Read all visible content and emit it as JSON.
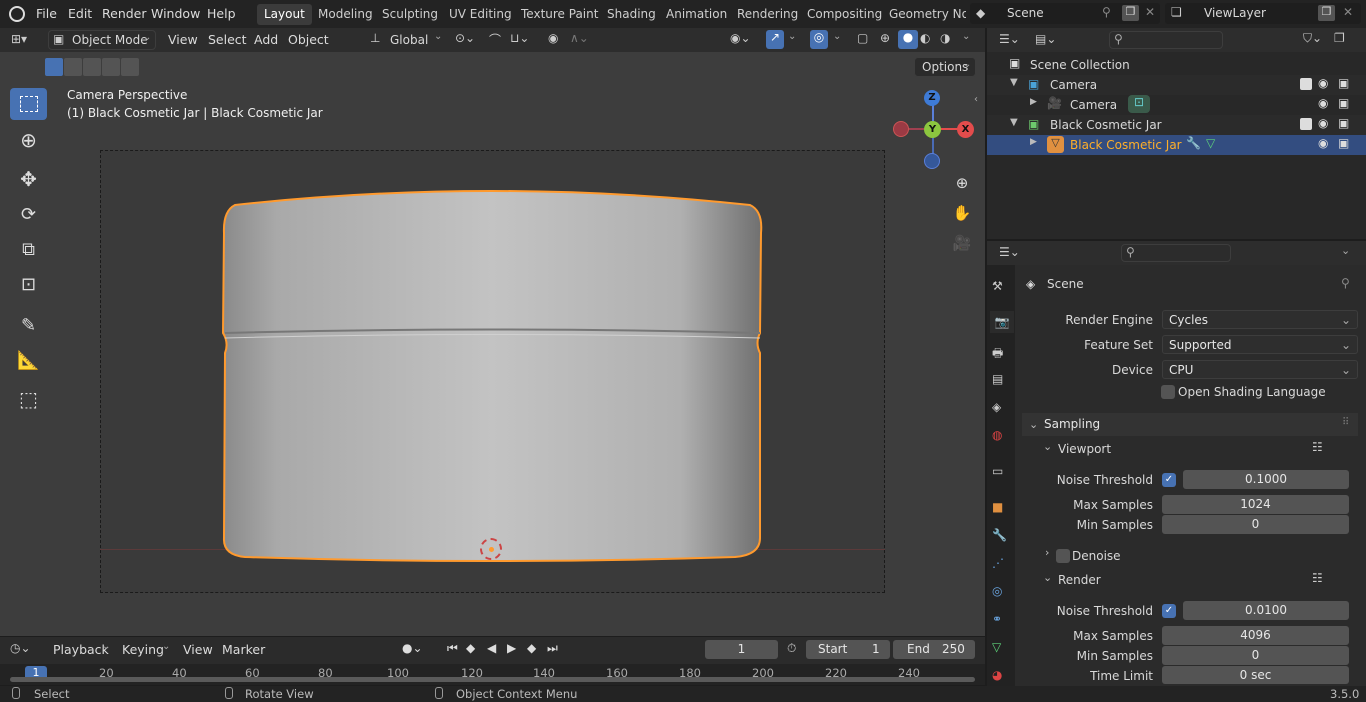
{
  "topbar": {
    "menus": [
      "File",
      "Edit",
      "Render",
      "Window",
      "Help"
    ],
    "workspaces": [
      "Layout",
      "Modeling",
      "Sculpting",
      "UV Editing",
      "Texture Paint",
      "Shading",
      "Animation",
      "Rendering",
      "Compositing",
      "Geometry Noc"
    ],
    "scene": "Scene",
    "view_layer": "ViewLayer"
  },
  "viewport": {
    "mode": "Object Mode",
    "menus": [
      "View",
      "Select",
      "Add",
      "Object"
    ],
    "orientation": "Global",
    "options": "Options",
    "overlay_title": "Camera Perspective",
    "overlay_subtitle": "(1) Black Cosmetic Jar | Black Cosmetic Jar",
    "gizmo": {
      "z": "Z",
      "y": "Y",
      "x": "X"
    },
    "accent": "#ff9a2e"
  },
  "outliner": {
    "rows": [
      {
        "label": "Scene Collection"
      },
      {
        "label": "Camera"
      },
      {
        "label": "Camera"
      },
      {
        "label": "Black Cosmetic Jar"
      },
      {
        "label": "Black Cosmetic Jar"
      }
    ]
  },
  "properties": {
    "title": "Scene",
    "render_engine_label": "Render Engine",
    "render_engine": "Cycles",
    "feature_set_label": "Feature Set",
    "feature_set": "Supported",
    "device_label": "Device",
    "device": "CPU",
    "osl_label": "Open Shading Language",
    "sampling": "Sampling",
    "viewport": "Viewport",
    "vp_noise_label": "Noise Threshold",
    "vp_noise": "0.1000",
    "vp_max_label": "Max Samples",
    "vp_max": "1024",
    "vp_min_label": "Min Samples",
    "vp_min": "0",
    "denoise": "Denoise",
    "render": "Render",
    "r_noise_label": "Noise Threshold",
    "r_noise": "0.0100",
    "r_max_label": "Max Samples",
    "r_max": "4096",
    "r_min_label": "Min Samples",
    "r_min": "0",
    "time_limit_label": "Time Limit",
    "time_limit": "0 sec"
  },
  "timeline": {
    "menus": [
      "Playback",
      "Keying",
      "View",
      "Marker"
    ],
    "current_frame": "1",
    "start_label": "Start",
    "start": "1",
    "end_label": "End",
    "end": "250",
    "ticks": [
      "1",
      "20",
      "40",
      "60",
      "80",
      "100",
      "120",
      "140",
      "160",
      "180",
      "200",
      "220",
      "240"
    ]
  },
  "statusbar": {
    "select": "Select",
    "rotate": "Rotate View",
    "context": "Object Context Menu",
    "version": "3.5.0"
  }
}
